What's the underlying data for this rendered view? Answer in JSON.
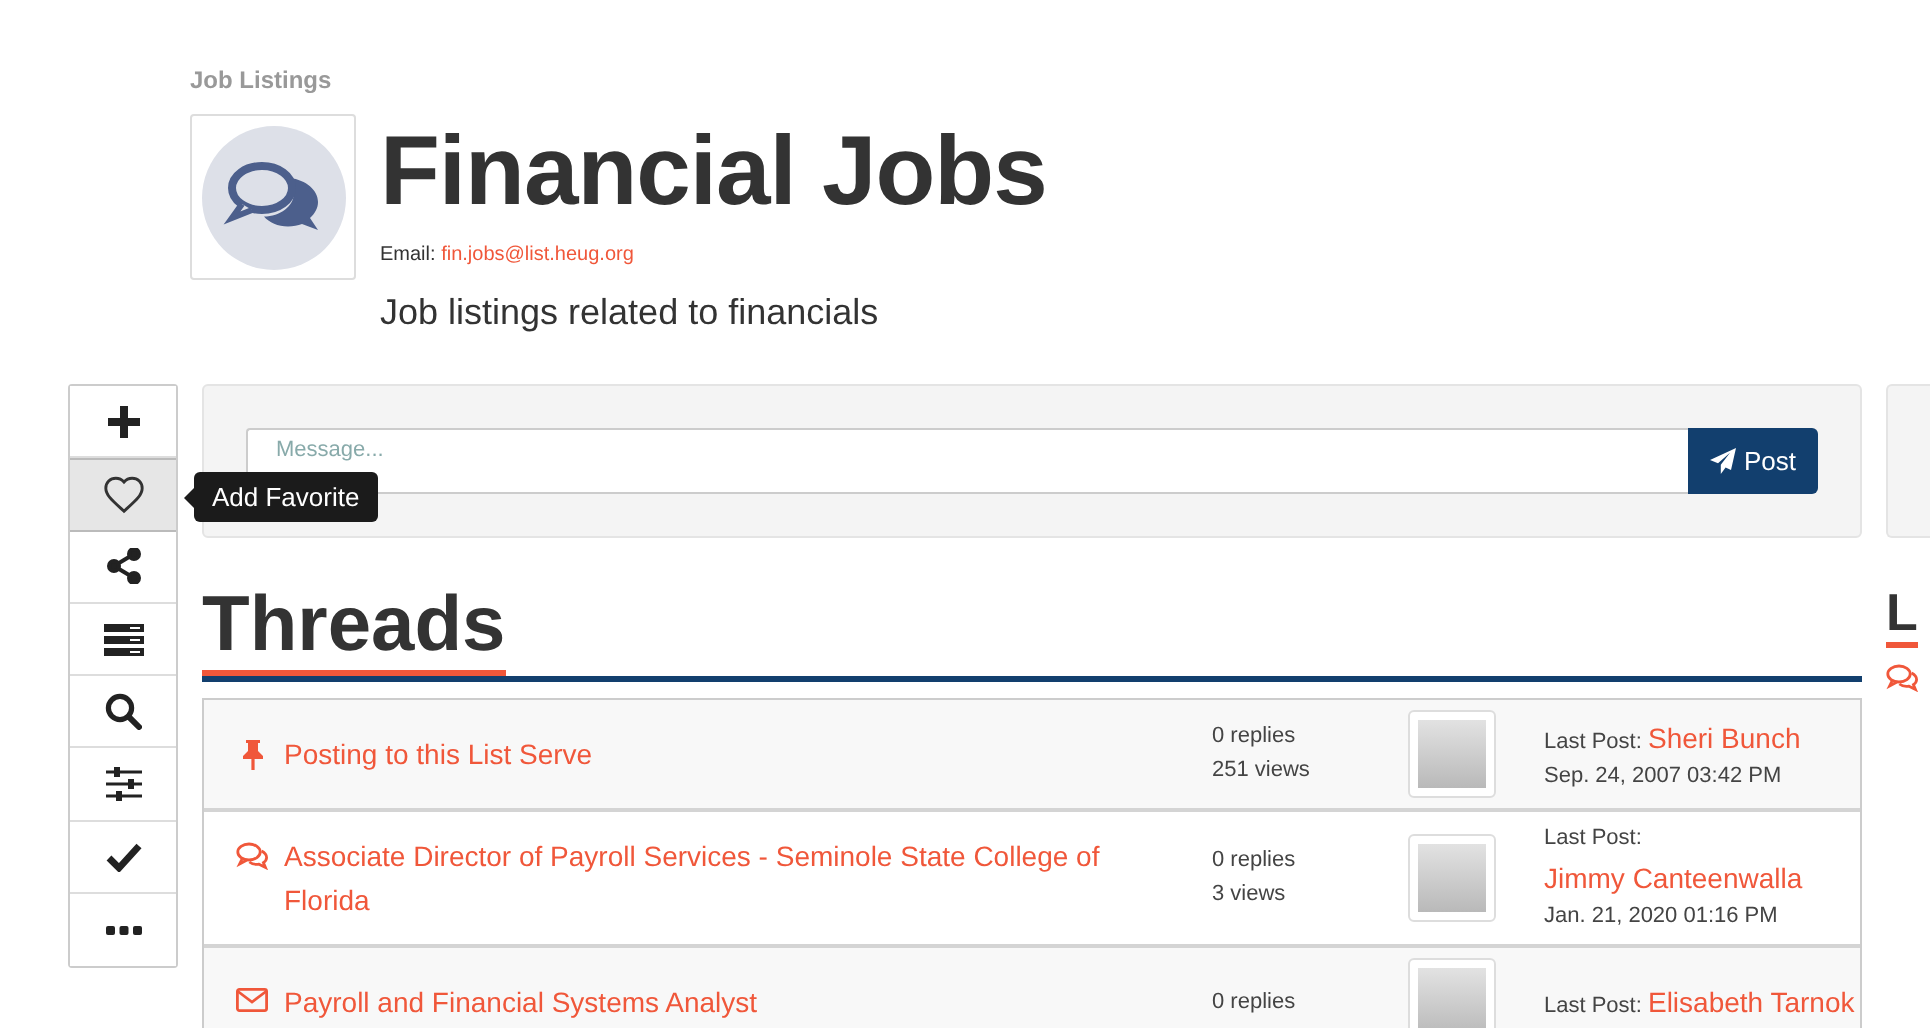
{
  "breadcrumb": "Job Listings",
  "group": {
    "title": "Financial Jobs",
    "email_label": "Email:",
    "email": "fin.jobs@list.heug.org",
    "description": "Job listings related to financials"
  },
  "toolbar": [
    {
      "kind": "plus",
      "hovered": false
    },
    {
      "kind": "heart",
      "hovered": true
    },
    {
      "kind": "share",
      "hovered": false
    },
    {
      "kind": "bars",
      "hovered": false
    },
    {
      "kind": "search",
      "hovered": false
    },
    {
      "kind": "sliders",
      "hovered": false
    },
    {
      "kind": "check",
      "hovered": false
    },
    {
      "kind": "ellipsis",
      "hovered": false
    }
  ],
  "tooltip": {
    "text": "Add Favorite"
  },
  "composer": {
    "placeholder": "Message...",
    "button": "Post"
  },
  "threads": {
    "heading": "Threads",
    "rows": [
      {
        "kind": "pinned",
        "title": "Posting to this List Serve",
        "replies": "0 replies",
        "views": "251 views",
        "last_post_label": "Last Post:",
        "author": "Sheri Bunch",
        "date": "Sep. 24, 2007 03:42 PM"
      },
      {
        "kind": "discussion",
        "title": "Associate Director of Payroll Services - Seminole State College of Florida",
        "replies": "0 replies",
        "views": "3 views",
        "last_post_label": "Last Post:",
        "author": "Jimmy Canteenwalla",
        "date": "Jan. 21, 2020 01:16 PM"
      },
      {
        "kind": "message",
        "title": "Payroll and Financial Systems Analyst",
        "replies": "0 replies",
        "last_post_label": "Last Post:",
        "author": "Elisabeth Tarnok"
      }
    ]
  },
  "side": {
    "heading": "L"
  }
}
